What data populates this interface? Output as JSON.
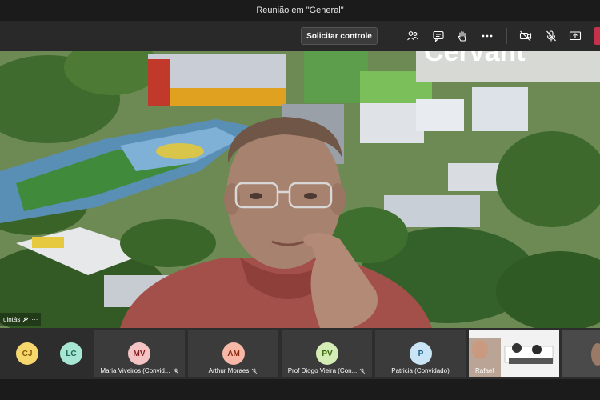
{
  "window": {
    "title": "Reunião em \"General\""
  },
  "toolbar": {
    "control_label": "Solicitar controle",
    "icons": [
      "participants-icon",
      "chat-icon",
      "raise-hand-icon",
      "more-icon",
      "camera-off-icon",
      "mic-off-icon",
      "share-icon"
    ]
  },
  "stage": {
    "sign_text": "Cervant",
    "participant_label": "uintás"
  },
  "participants": [
    {
      "initials": "CJ",
      "name": "",
      "color": "#f5d76e",
      "text_color": "#8a5a00"
    },
    {
      "initials": "LC",
      "name": "",
      "color": "#a8e6d4",
      "text_color": "#1d6b56"
    },
    {
      "initials": "MV",
      "name": "Maria Viveiros (Convid...",
      "color": "#f4c4c4",
      "text_color": "#8a1f1f"
    },
    {
      "initials": "AM",
      "name": "Arthur Moraes",
      "color": "#f7b8a8",
      "text_color": "#8a2a10"
    },
    {
      "initials": "PV",
      "name": "Prof Diogo Vieira (Con...",
      "color": "#d4ecb5",
      "text_color": "#3b6b10"
    },
    {
      "initials": "P",
      "name": "Patricia (Convidado)",
      "color": "#c9e4f5",
      "text_color": "#1b5c85"
    },
    {
      "initials": "",
      "name": "Rafael",
      "color": "",
      "text_color": ""
    }
  ]
}
